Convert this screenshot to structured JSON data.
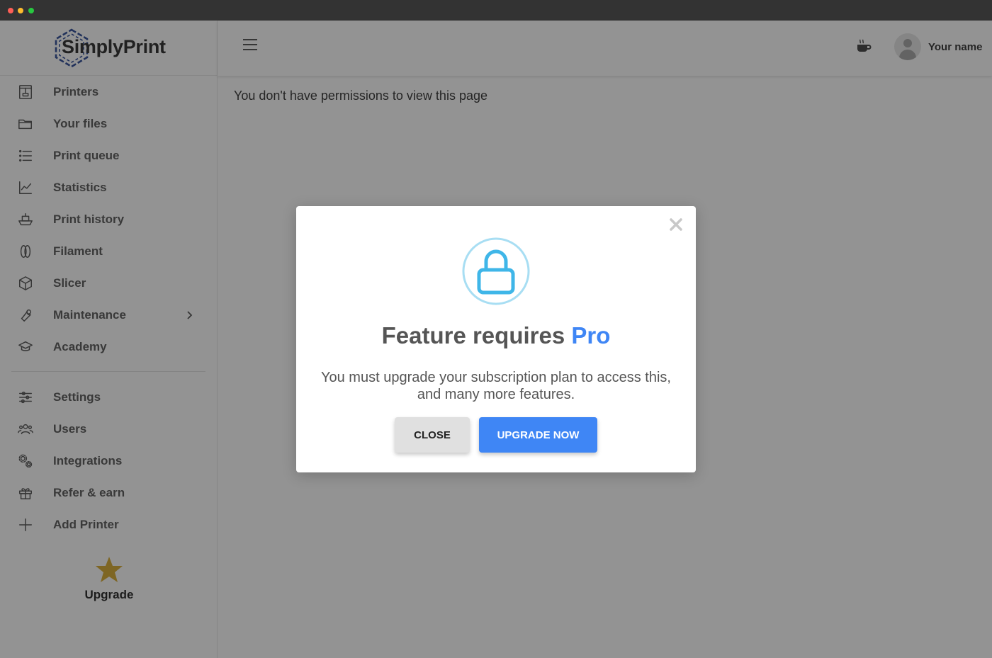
{
  "app": {
    "logo_text": "SimplyPrint"
  },
  "sidebar": {
    "items": [
      {
        "label": "Printers",
        "icon": "printer-icon"
      },
      {
        "label": "Your files",
        "icon": "folder-icon"
      },
      {
        "label": "Print queue",
        "icon": "list-icon"
      },
      {
        "label": "Statistics",
        "icon": "chart-icon"
      },
      {
        "label": "Print history",
        "icon": "ship-icon"
      },
      {
        "label": "Filament",
        "icon": "filament-icon"
      },
      {
        "label": "Slicer",
        "icon": "cube-icon"
      },
      {
        "label": "Maintenance",
        "icon": "wrench-icon",
        "has_submenu": true
      },
      {
        "label": "Academy",
        "icon": "graduation-cap-icon"
      }
    ],
    "secondary_items": [
      {
        "label": "Settings",
        "icon": "sliders-icon"
      },
      {
        "label": "Users",
        "icon": "users-icon"
      },
      {
        "label": "Integrations",
        "icon": "gears-icon"
      },
      {
        "label": "Refer & earn",
        "icon": "gift-icon"
      },
      {
        "label": "Add Printer",
        "icon": "plus-icon"
      }
    ],
    "upgrade_label": "Upgrade"
  },
  "header": {
    "user_name": "Your name"
  },
  "main": {
    "message": "You don't have permissions to view this page"
  },
  "modal": {
    "title_prefix": "Feature requires",
    "title_highlight": "Pro",
    "text": "You must upgrade your subscription plan to access this, and many more features.",
    "close_label": "Close",
    "upgrade_label": "Upgrade now"
  },
  "colors": {
    "accent": "#3f86f5",
    "lock": "#3fb6e8",
    "star": "#d4a420",
    "overlay": "rgba(40,40,40,0.5)"
  }
}
